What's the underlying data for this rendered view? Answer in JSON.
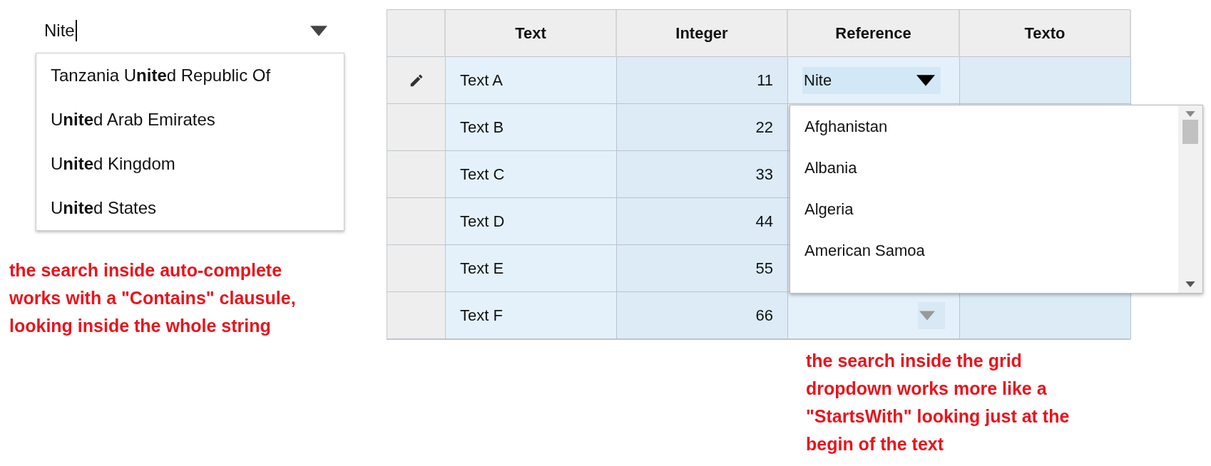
{
  "autocomplete": {
    "value": "Nite",
    "options": [
      "Tanzania U**nite**d Republic Of",
      "U**nite**d Arab Emirates",
      "U**nite**d Kingdom",
      "U**nite**d States"
    ]
  },
  "left_note": "the search inside auto-complete works with a \"Contains\" clausule, looking inside the whole string",
  "grid": {
    "columns": [
      "Text",
      "Integer",
      "Reference",
      "Texto"
    ],
    "rows": [
      {
        "editing": true,
        "text": "Text A",
        "integer": "11",
        "reference": {
          "kind": "active",
          "value": "Nite"
        }
      },
      {
        "editing": false,
        "text": "Text B",
        "integer": "22"
      },
      {
        "editing": false,
        "text": "Text C",
        "integer": "33"
      },
      {
        "editing": false,
        "text": "Text D",
        "integer": "44"
      },
      {
        "editing": false,
        "text": "Text E",
        "integer": "55"
      },
      {
        "editing": false,
        "text": "Text F",
        "integer": "66",
        "reference": {
          "kind": "inactive"
        }
      }
    ],
    "dropdown": {
      "options": [
        "Afghanistan",
        "Albania",
        "Algeria",
        "American Samoa"
      ]
    }
  },
  "right_note": "the search inside the grid dropdown works more like a \"StartsWith\" looking just at the begin of the text"
}
